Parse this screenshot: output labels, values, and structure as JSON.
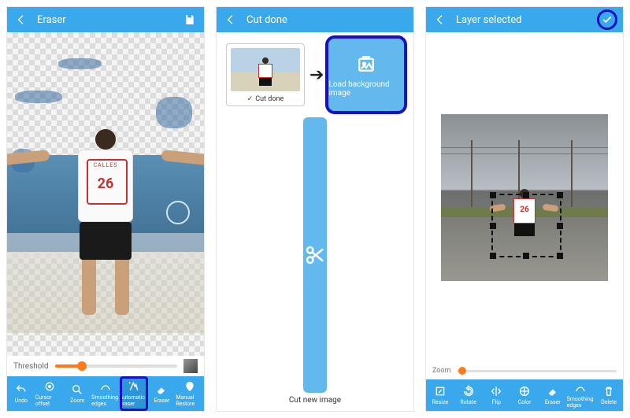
{
  "screens": [
    {
      "title": "Eraser",
      "jersey_name": "CALLES",
      "jersey_number": "26",
      "threshold_label": "Threshold",
      "tools": [
        "Undo",
        "Cursor offset",
        "Zoom",
        "Smoothing edges",
        "Automatic eraser",
        "Eraser",
        "Manual Restore"
      ]
    },
    {
      "title": "Cut done",
      "cut_done_label": "Cut done",
      "load_bg_label": "Load background image",
      "cut_new_label": "Cut new image"
    },
    {
      "title": "Layer selected",
      "jersey_number": "26",
      "zoom_label": "Zoom",
      "tools": [
        "Resize",
        "Rotate",
        "Flip",
        "Color",
        "Eraser",
        "Smoothing edges",
        "Delete"
      ]
    }
  ]
}
